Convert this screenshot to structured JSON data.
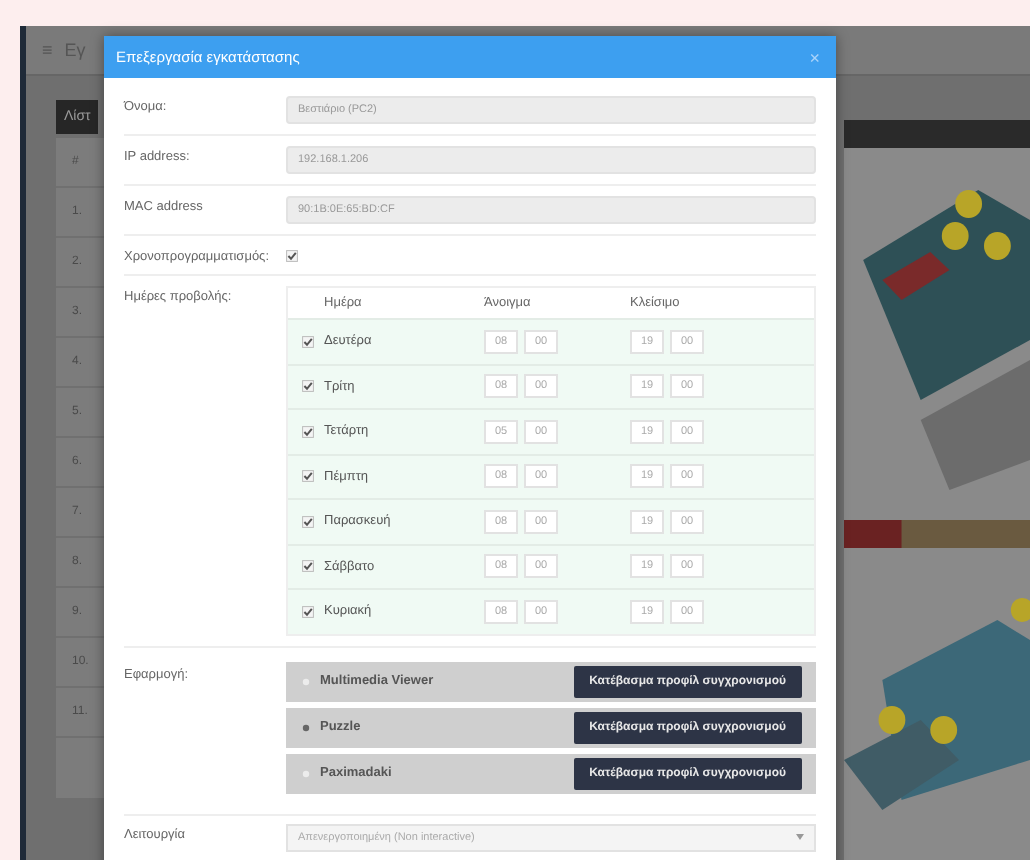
{
  "background_app": {
    "menu_icon": "≡",
    "title": "Εγ",
    "tab": "Λίστ",
    "table": {
      "columns": [
        "#"
      ],
      "rows": [
        "1.",
        "2.",
        "3.",
        "4.",
        "5.",
        "6.",
        "7.",
        "8.",
        "9.",
        "10.",
        "11."
      ]
    }
  },
  "dialog": {
    "title": "Επεξεργασία εγκατάστασης",
    "close": "×",
    "fields": [
      {
        "label": "Όνομα:",
        "value": "Βεστιάριο (PC2)"
      },
      {
        "label": "IP address:",
        "value": "192.168.1.206"
      },
      {
        "label": "MAC address",
        "value": "90:1B:0E:65:BD:CF"
      }
    ],
    "scheduling": {
      "label": "Χρονοπρογραμματισμός:",
      "checked": true
    },
    "schedule": {
      "label": "Ημέρες προβολής:",
      "columns": [
        "Ημέρα",
        "Άνοιγμα",
        "Κλείσιμο"
      ],
      "days": [
        {
          "checked": true,
          "day": "Δευτέρα",
          "open_hour": "08",
          "open_minute": "00",
          "close_hour": "19",
          "close_minute": "00"
        },
        {
          "checked": true,
          "day": "Τρίτη",
          "open_hour": "08",
          "open_minute": "00",
          "close_hour": "19",
          "close_minute": "00"
        },
        {
          "checked": true,
          "day": "Τετάρτη",
          "open_hour": "05",
          "open_minute": "00",
          "close_hour": "19",
          "close_minute": "00"
        },
        {
          "checked": true,
          "day": "Πέμπτη",
          "open_hour": "08",
          "open_minute": "00",
          "close_hour": "19",
          "close_minute": "00"
        },
        {
          "checked": true,
          "day": "Παρασκευή",
          "open_hour": "08",
          "open_minute": "00",
          "close_hour": "19",
          "close_minute": "00"
        },
        {
          "checked": true,
          "day": "Σάββατο",
          "open_hour": "08",
          "open_minute": "00",
          "close_hour": "19",
          "close_minute": "00"
        },
        {
          "checked": true,
          "day": "Κυριακή",
          "open_hour": "08",
          "open_minute": "00",
          "close_hour": "19",
          "close_minute": "00"
        }
      ]
    },
    "application": {
      "label": "Εφαρμογή:",
      "apps": [
        {
          "name": "Multimedia Viewer",
          "selected": false,
          "button": "Κατέβασμα προφίλ συγχρονισμού"
        },
        {
          "name": "Puzzle",
          "selected": true,
          "button": "Κατέβασμα προφίλ συγχρονισμού"
        },
        {
          "name": "Paximadaki",
          "selected": false,
          "button": "Κατέβασμα προφίλ συγχρονισμού"
        }
      ]
    },
    "mode": {
      "label": "Λειτουργία",
      "value": "Απενεργοποιημένη (Non interactive)"
    }
  }
}
